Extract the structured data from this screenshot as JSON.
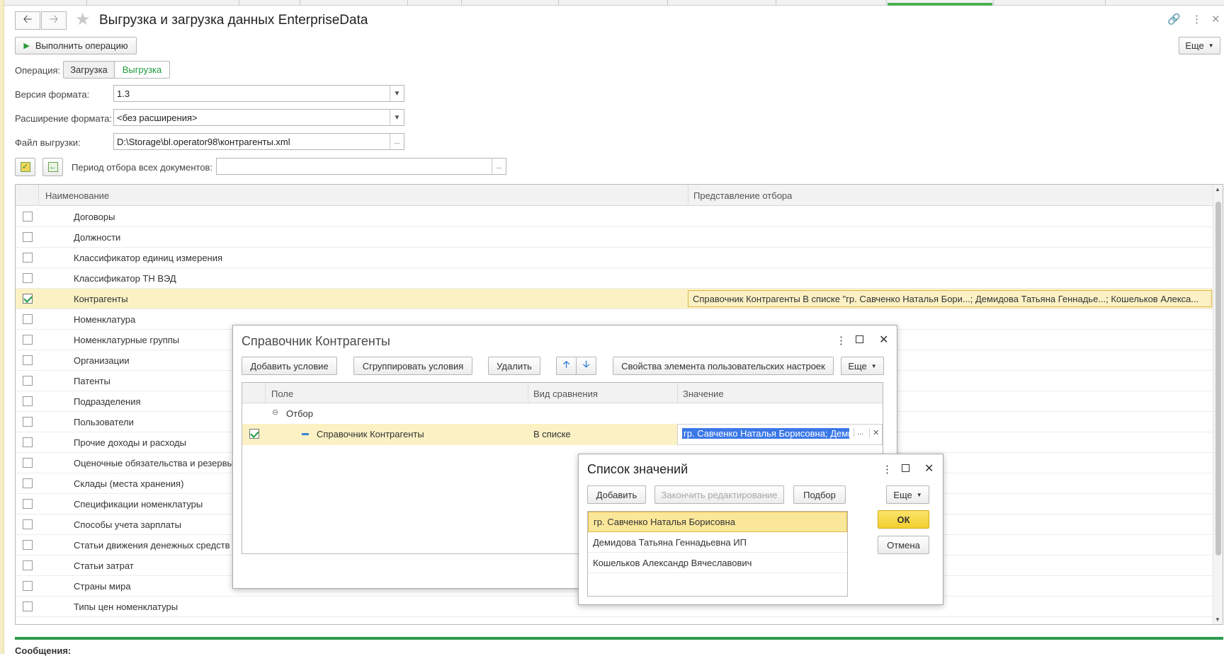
{
  "window": {
    "title": "Выгрузка и загрузка данных EnterpriseData",
    "more_label": "Еще"
  },
  "toolbar": {
    "run_label": "Выполнить операцию"
  },
  "operation": {
    "label": "Операция:",
    "options": [
      "Загрузка",
      "Выгрузка"
    ],
    "selected": "Выгрузка"
  },
  "format_version": {
    "label": "Версия формата:",
    "value": "1.3"
  },
  "format_extension": {
    "label": "Расширение формата:",
    "value": "<без расширения>"
  },
  "export_file": {
    "label": "Файл выгрузки:",
    "value": "D:\\Storage\\bl.operator98\\контрагенты.xml"
  },
  "period": {
    "label": "Период отбора всех документов:",
    "value": ""
  },
  "grid": {
    "columns": [
      "Наименование",
      "Представление отбора"
    ],
    "rows": [
      {
        "name": "Договоры",
        "checked": false,
        "filter": ""
      },
      {
        "name": "Должности",
        "checked": false,
        "filter": ""
      },
      {
        "name": "Классификатор единиц измерения",
        "checked": false,
        "filter": ""
      },
      {
        "name": "Классификатор ТН ВЭД",
        "checked": false,
        "filter": ""
      },
      {
        "name": "Контрагенты",
        "checked": true,
        "filter": "Справочник Контрагенты В списке \"гр. Савченко Наталья Бори...; Демидова Татьяна Геннадье...; Кошельков Алекса..."
      },
      {
        "name": "Номенклатура",
        "checked": false,
        "filter": ""
      },
      {
        "name": "Номенклатурные группы",
        "checked": false,
        "filter": ""
      },
      {
        "name": "Организации",
        "checked": false,
        "filter": ""
      },
      {
        "name": "Патенты",
        "checked": false,
        "filter": ""
      },
      {
        "name": "Подразделения",
        "checked": false,
        "filter": ""
      },
      {
        "name": "Пользователи",
        "checked": false,
        "filter": ""
      },
      {
        "name": "Прочие доходы и расходы",
        "checked": false,
        "filter": ""
      },
      {
        "name": "Оценочные обязательства и резервы",
        "checked": false,
        "filter": ""
      },
      {
        "name": "Склады (места хранения)",
        "checked": false,
        "filter": ""
      },
      {
        "name": "Спецификации номенклатуры",
        "checked": false,
        "filter": ""
      },
      {
        "name": "Способы учета зарплаты",
        "checked": false,
        "filter": ""
      },
      {
        "name": "Статьи движения денежных средств",
        "checked": false,
        "filter": ""
      },
      {
        "name": "Статьи затрат",
        "checked": false,
        "filter": ""
      },
      {
        "name": "Страны мира",
        "checked": false,
        "filter": ""
      },
      {
        "name": "Типы цен номенклатуры",
        "checked": false,
        "filter": ""
      }
    ]
  },
  "filter_dialog": {
    "title": "Справочник Контрагенты",
    "buttons": {
      "add_condition": "Добавить условие",
      "group_conditions": "Сгруппировать условия",
      "delete": "Удалить",
      "properties": "Свойства элемента пользовательских настроек",
      "more": "Еще"
    },
    "columns": [
      "Поле",
      "Вид сравнения",
      "Значение"
    ],
    "group_row": "Отбор",
    "condition": {
      "field": "Справочник Контрагенты",
      "comparison": "В списке",
      "value": "гр. Савченко Наталья Борисовна; Демидова"
    }
  },
  "values_dialog": {
    "title": "Список значений",
    "buttons": {
      "add": "Добавить",
      "finish_edit": "Закончить редактирование",
      "pick": "Подбор",
      "more": "Еще",
      "ok": "ОК",
      "cancel": "Отмена"
    },
    "items": [
      "гр. Савченко Наталья Борисовна",
      "Демидова Татьяна Геннадьевна ИП",
      "Кошельков Александр Вячеславович"
    ]
  },
  "messages_label": "Сообщения:"
}
